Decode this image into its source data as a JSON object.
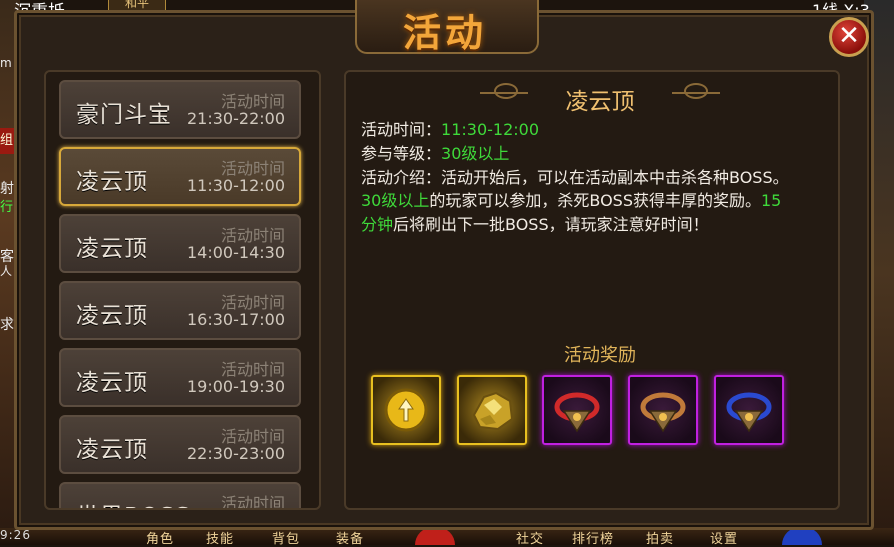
{
  "hud": {
    "top_left": "沉重抵",
    "top_tab": "和平",
    "top_right": "1线 X:3",
    "side_red": "组",
    "side_green": "行",
    "side_texts": [
      "m",
      "射",
      "客",
      "人",
      "求"
    ],
    "bottom_menu": [
      "角色",
      "技能",
      "背包",
      "装备",
      "社交",
      "排行榜",
      "拍卖",
      "设置"
    ],
    "bottom_left_time": "9:26"
  },
  "window": {
    "title": "活动",
    "close_icon": "✕"
  },
  "activities": [
    {
      "name": "豪门斗宝",
      "label": "活动时间",
      "time": "21:30-22:00",
      "selected": false
    },
    {
      "name": "凌云顶",
      "label": "活动时间",
      "time": "11:30-12:00",
      "selected": true
    },
    {
      "name": "凌云顶",
      "label": "活动时间",
      "time": "14:00-14:30",
      "selected": false
    },
    {
      "name": "凌云顶",
      "label": "活动时间",
      "time": "16:30-17:00",
      "selected": false
    },
    {
      "name": "凌云顶",
      "label": "活动时间",
      "time": "19:00-19:30",
      "selected": false
    },
    {
      "name": "凌云顶",
      "label": "活动时间",
      "time": "22:30-23:00",
      "selected": false
    },
    {
      "name": "世界BOSS",
      "label": "活动时间",
      "time": "",
      "selected": false
    }
  ],
  "detail": {
    "title": "凌云顶",
    "time_label": "活动时间：",
    "time_value": "11:30-12:00",
    "level_label": "参与等级：",
    "level_value": "30级以上",
    "intro_line1": "活动介绍：活动开始后，可以在活动副本中击杀各种BOSS。",
    "intro_line2_green": "30级以上",
    "intro_line2_rest": "的玩家可以参加，杀死BOSS获得丰厚的奖励。",
    "intro_line2_tail_green": "15",
    "intro_line3_green": "分钟",
    "intro_line3_rest": "后将刷出下一批BOSS，请玩家注意好时间！",
    "reward_title": "活动奖励",
    "rewards": [
      {
        "icon": "gold-coin-icon",
        "frame": "gold"
      },
      {
        "icon": "gold-ore-icon",
        "frame": "gold"
      },
      {
        "icon": "red-ring-icon",
        "frame": "purple"
      },
      {
        "icon": "bronze-ring-icon",
        "frame": "purple"
      },
      {
        "icon": "blue-ring-icon",
        "frame": "purple"
      }
    ]
  },
  "colors": {
    "title_orange": "#f3a63a",
    "highlight_green": "#3fd93a",
    "selected_border": "#d8a93a",
    "gold_frame": "#e8c020",
    "purple_frame": "#c020e0"
  }
}
